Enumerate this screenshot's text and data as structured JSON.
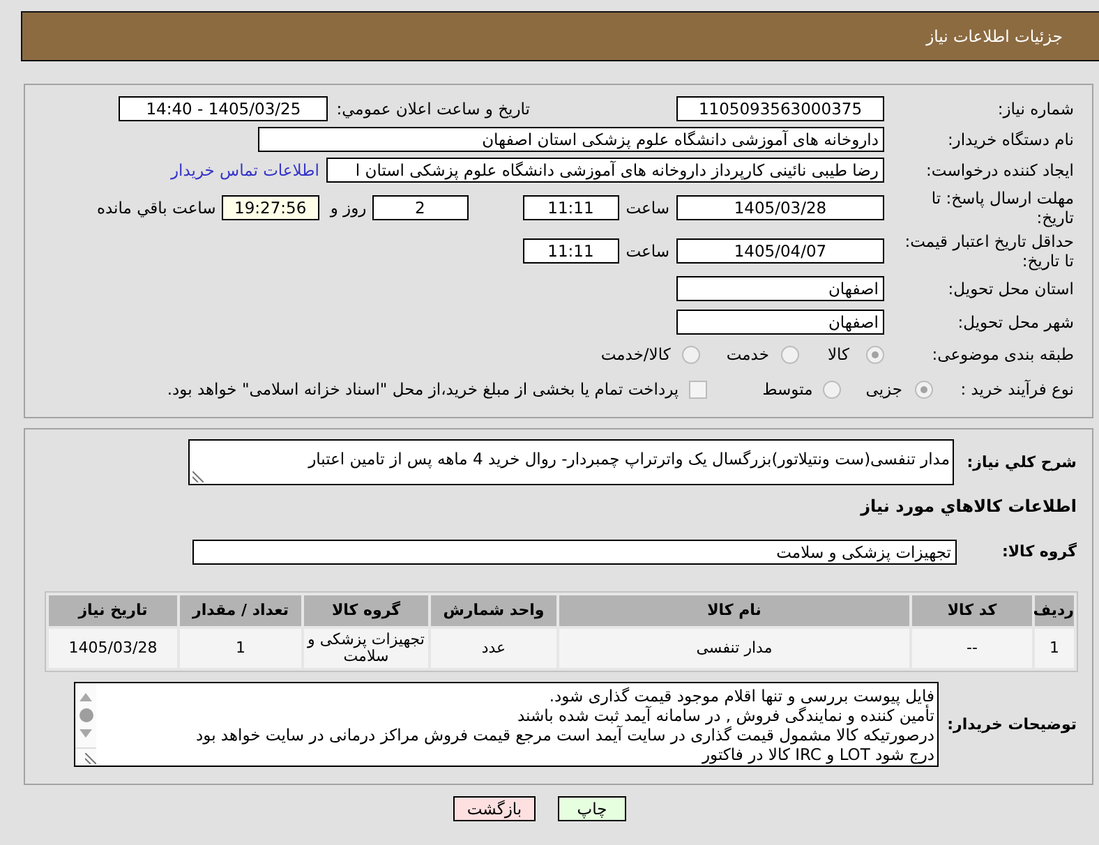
{
  "header": {
    "title": "جزئیات اطلاعات نیاز"
  },
  "need_info": {
    "need_number": {
      "label": "شماره نیاز:",
      "value": "1105093563000375"
    },
    "announcement": {
      "label": "تاریخ و ساعت اعلان عمومي:",
      "value": "1405/03/25 - 14:40"
    },
    "buyer_org": {
      "label": "نام دستگاه خریدار:",
      "value": "داروخانه های آموزشی دانشگاه علوم پزشکی استان اصفهان"
    },
    "requester": {
      "label": "ایجاد کننده درخواست:",
      "value": "رضا طیبی نائینی کارپرداز داروخانه های آموزشی دانشگاه علوم پزشکی استان ا",
      "link": "اطلاعات تماس خریدار"
    },
    "reply_deadline": {
      "label": "مهلت ارسال پاسخ: تا تاریخ:",
      "date": "1405/03/28",
      "time_label": "ساعت",
      "time": "11:11",
      "days": "2",
      "days_label": "روز و",
      "remaining": "19:27:56",
      "remaining_label": "ساعت باقي مانده"
    },
    "price_validity": {
      "label": "حداقل تاریخ اعتبار قیمت: تا تاریخ:",
      "date": "1405/04/07",
      "time_label": "ساعت",
      "time": "11:11"
    },
    "delivery_province": {
      "label": "استان محل تحویل:",
      "value": "اصفهان"
    },
    "delivery_city": {
      "label": "شهر محل تحویل:",
      "value": "اصفهان"
    },
    "subject_category": {
      "label": "طبقه بندی موضوعی:",
      "options": [
        {
          "label": "کالا",
          "selected": true
        },
        {
          "label": "خدمت",
          "selected": false
        },
        {
          "label": "کالا/خدمت",
          "selected": false
        }
      ]
    },
    "purchase_process": {
      "label": "نوع فرآیند خرید :",
      "options": [
        {
          "label": "جزیی",
          "selected": true
        },
        {
          "label": "متوسط",
          "selected": false
        }
      ],
      "treasury_payment": {
        "label": "پرداخت تمام یا بخشی از مبلغ خرید،از محل \"اسناد خزانه اسلامی\" خواهد بود.",
        "checked": false
      }
    }
  },
  "items_section": {
    "description": {
      "label": "شرح کلي نیاز:",
      "value": "مدار تنفسی(ست ونتیلاتور)بزرگسال یک واترتراپ چمبردار- روال خرید 4 ماهه پس از تامین اعتبار"
    },
    "title": "اطلاعات کالاهاي مورد نیاز",
    "goods_group": {
      "label": "گروه کالا:",
      "value": "تجهیزات پزشکی و سلامت"
    },
    "table": {
      "columns": [
        "ردیف",
        "کد کالا",
        "نام کالا",
        "واحد شمارش",
        "گروه کالا",
        "تعداد / مقدار",
        "تاریخ نیاز"
      ],
      "rows": [
        [
          "1",
          "--",
          "مدار تنفسی",
          "عدد",
          "تجهیزات پزشکی و سلامت",
          "1",
          "1405/03/28"
        ]
      ]
    },
    "buyer_notes": {
      "label": "توضیحات خریدار:",
      "lines": [
        "فایل پیوست بررسی و تنها اقلام موجود قیمت گذاری شود.",
        "تأمین کننده و نمایندگی فروش , در سامانه آیمد ثبت شده باشند",
        "درصورتیکه کالا مشمول قیمت گذاری در سایت آیمد است مرجع قیمت فروش مراکز درمانی در سایت خواهد بود",
        "درج شود LOT و IRC کالا در فاکتور"
      ]
    }
  },
  "buttons": [
    {
      "label": "چاپ",
      "kind": "print"
    },
    {
      "label": "بازگشت",
      "kind": "back"
    }
  ]
}
